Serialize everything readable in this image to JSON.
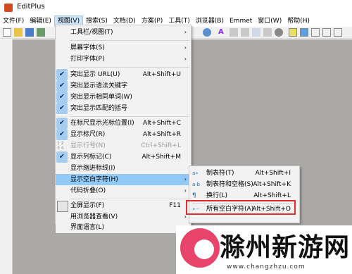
{
  "app": {
    "title": "EditPlus"
  },
  "menubar": [
    {
      "label": "文件(F)"
    },
    {
      "label": "编辑(E)"
    },
    {
      "label": "视图(V)"
    },
    {
      "label": "搜索(S)"
    },
    {
      "label": "文档(D)"
    },
    {
      "label": "方案(P)"
    },
    {
      "label": "工具(T)"
    },
    {
      "label": "浏览器(B)"
    },
    {
      "label": "Emmet"
    },
    {
      "label": "窗口(W)"
    },
    {
      "label": "帮助(H)"
    }
  ],
  "view_menu": {
    "items": [
      {
        "label": "工具栏/视图(T)",
        "arrow": "›",
        "shortcut": ""
      },
      {
        "label": "屏幕字体(S)",
        "arrow": "›",
        "shortcut": ""
      },
      {
        "label": "打印字体(P)",
        "arrow": "›",
        "shortcut": ""
      },
      {
        "label": "突出显示 URL(U)",
        "shortcut": "Alt+Shift+U"
      },
      {
        "label": "突出显示语法关键字",
        "shortcut": ""
      },
      {
        "label": "突出显示相同单词(W)",
        "shortcut": ""
      },
      {
        "label": "突出显示匹配的括号",
        "shortcut": ""
      },
      {
        "label": "在标尺显示光标位置(I)",
        "shortcut": "Alt+Shift+C"
      },
      {
        "label": "显示标尺(R)",
        "shortcut": "Alt+Shift+R"
      },
      {
        "label": "显示行号(N)",
        "shortcut": "Ctrl+Shift+L"
      },
      {
        "label": "显示列标记(C)",
        "shortcut": "Alt+Shift+M"
      },
      {
        "label": "显示缩进标线(I)",
        "shortcut": ""
      },
      {
        "label": "显示空白字符(H)",
        "arrow": "›",
        "shortcut": ""
      },
      {
        "label": "代码折叠(O)",
        "arrow": "›",
        "shortcut": ""
      },
      {
        "label": "全屏显示(F)",
        "shortcut": "F11"
      },
      {
        "label": "用浏览器查看(V)",
        "arrow": "›",
        "shortcut": ""
      },
      {
        "label": "界面语言(L)",
        "arrow": "›",
        "shortcut": ""
      }
    ]
  },
  "whitespace_submenu": {
    "items": [
      {
        "icon": "a»",
        "label": "制表符(T)",
        "shortcut": "Alt+Shift+I"
      },
      {
        "icon": "a·b",
        "label": "制表符和空格(S)",
        "shortcut": "Alt+Shift+K"
      },
      {
        "icon": "¶",
        "label": "换行(L)",
        "shortcut": "Alt+Shift+L"
      },
      {
        "icon": "»···",
        "label": "所有空白字符(A)",
        "shortcut": "Alt+Shift+O"
      }
    ]
  },
  "watermark": {
    "text": "滁州新游网",
    "url": "www.changzhzu.com"
  },
  "colors": {
    "highlight": "#91c9f7",
    "red_box": "#e03030",
    "workspace": "#aba9a6"
  }
}
